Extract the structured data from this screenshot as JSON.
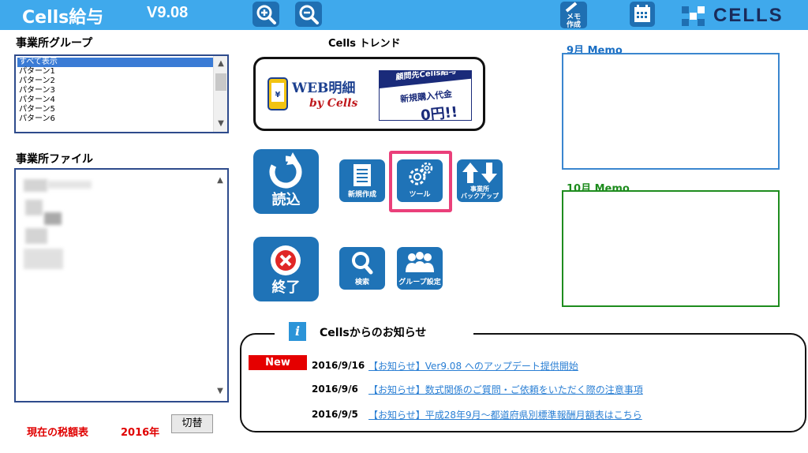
{
  "header": {
    "title": "Cells給与",
    "version": "V9.08",
    "zoom_in_icon": "zoom-in-icon",
    "zoom_out_icon": "zoom-out-icon",
    "memo_create_label": "メモ作成",
    "calendar_icon": "calendar-icon",
    "logo_text": "CELLS",
    "bg_color": "#3fa9ec"
  },
  "office_group": {
    "label": "事業所グループ",
    "items": [
      "すべて表示",
      "パターン1",
      "パターン2",
      "パターン3",
      "パターン4",
      "パターン5",
      "パターン6"
    ],
    "selected_index": 0
  },
  "office_file": {
    "label": "事業所ファイル"
  },
  "tax": {
    "label": "現在の税額表",
    "year": "2016年",
    "switch_label": "切替"
  },
  "trend": {
    "title": "Cells トレンド",
    "banner_web": "WEB明細",
    "banner_by": "by Cells",
    "banner_top": "顧問先Cells給与",
    "banner_mid": "新規購入代金",
    "banner_price": "0円!!"
  },
  "actions": {
    "load": "読込",
    "new": "新規作成",
    "tools": "ツール",
    "backup_line1": "事業所",
    "backup_line2": "バックアップ",
    "exit": "終了",
    "search": "検索",
    "group": "グループ設定"
  },
  "memo": {
    "sep_label": "9月 Memo",
    "oct_label": "10月 Memo",
    "sep_color": "#1b6fc4",
    "oct_color": "#1e8c1e"
  },
  "notices": {
    "title": "Cellsからのお知らせ",
    "new_badge": "New",
    "items": [
      {
        "date": "2016/9/16",
        "text": "【お知らせ】Ver9.08 へのアップデート提供開始"
      },
      {
        "date": "2016/9/6",
        "text": "【お知らせ】数式関係のご質問・ご依頼をいただく際の注意事項"
      },
      {
        "date": "2016/9/5",
        "text": "【お知らせ】平成28年9月～都道府県別標準報酬月額表はこちら"
      }
    ]
  }
}
